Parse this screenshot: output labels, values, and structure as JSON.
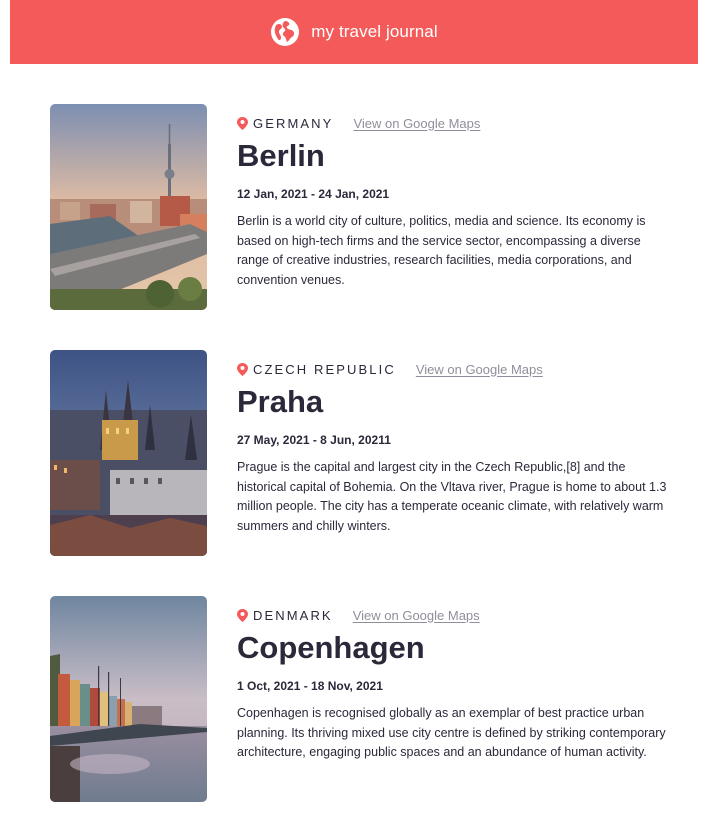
{
  "header": {
    "title": "my travel journal",
    "icon": "globe-icon",
    "background": "#f55a5a"
  },
  "entries": [
    {
      "country": "GERMANY",
      "maps_label": "View on Google Maps",
      "place": "Berlin",
      "dates": "12 Jan, 2021 - 24 Jan, 2021",
      "description": "Berlin is a world city of culture, politics, media and science. Its economy is based on high-tech firms and the service sector, encompassing a diverse range of creative industries, research facilities, media corporations, and convention venues."
    },
    {
      "country": "CZECH REPUBLIC",
      "maps_label": "View on Google Maps",
      "place": "Praha",
      "dates": "27 May, 2021 - 8 Jun, 20211",
      "description": "Prague is the capital and largest city in the Czech Republic,[8] and the historical capital of Bohemia. On the Vltava river, Prague is home to about 1.3 million people. The city has a temperate oceanic climate, with relatively warm summers and chilly winters."
    },
    {
      "country": "DENMARK",
      "maps_label": "View on Google Maps",
      "place": "Copenhagen",
      "dates": "1 Oct, 2021 - 18 Nov, 2021",
      "description": "Copenhagen is recognised globally as an exemplar of best practice urban planning. Its thriving mixed use city centre is defined by striking contemporary architecture, engaging public spaces and an abundance of human activity."
    }
  ],
  "colors": {
    "accent": "#f55a5a",
    "text": "#2b283a",
    "link": "#918e9b"
  },
  "icons": {
    "pin": "map-pin-icon"
  }
}
